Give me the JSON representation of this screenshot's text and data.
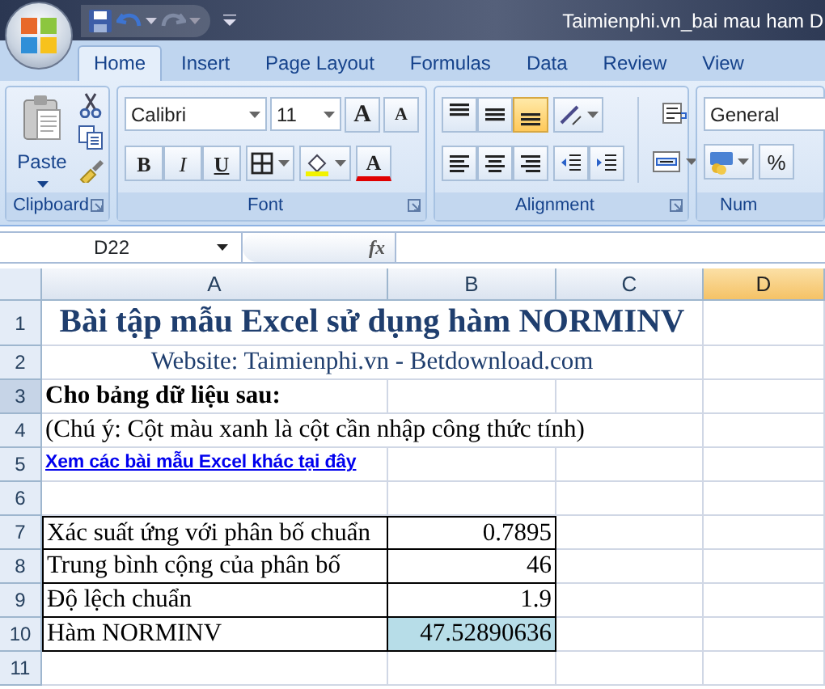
{
  "title_bar": {
    "title": "Taimienphi.vn_bai mau ham D"
  },
  "tabs": [
    {
      "label": "Home",
      "selected": true
    },
    {
      "label": "Insert",
      "selected": false
    },
    {
      "label": "Page Layout",
      "selected": false
    },
    {
      "label": "Formulas",
      "selected": false
    },
    {
      "label": "Data",
      "selected": false
    },
    {
      "label": "Review",
      "selected": false
    },
    {
      "label": "View",
      "selected": false
    }
  ],
  "ribbon": {
    "clipboard": {
      "label": "Clipboard",
      "paste": "Paste"
    },
    "font": {
      "label": "Font",
      "font_name": "Calibri",
      "font_size": "11",
      "grow": "A",
      "shrink": "A",
      "bold": "B",
      "italic": "I",
      "underline": "U",
      "font_color": "A"
    },
    "alignment": {
      "label": "Alignment",
      "vertical": [
        {
          "kind": "top",
          "selected": false
        },
        {
          "kind": "middle",
          "selected": false
        },
        {
          "kind": "bottom",
          "selected": true
        }
      ]
    },
    "number": {
      "label": "Num",
      "format": "General",
      "percent": "%"
    }
  },
  "formula_bar": {
    "name_box": "D22",
    "fx": "fx"
  },
  "sheet": {
    "columns": [
      {
        "label": "A",
        "selected": false
      },
      {
        "label": "B",
        "selected": false
      },
      {
        "label": "C",
        "selected": false
      },
      {
        "label": "D",
        "selected": true
      }
    ],
    "rows": [
      {
        "number": "1",
        "selected": false,
        "cells": [
          {
            "kind": "title",
            "text": "Bài tập mẫu Excel sử dụng hàm NORMINV"
          }
        ]
      },
      {
        "number": "2",
        "selected": false,
        "cells": [
          {
            "kind": "subtitle",
            "text": "Website: Taimienphi.vn - Betdownload.com"
          }
        ]
      },
      {
        "number": "3",
        "selected": true,
        "cells": [
          {
            "kind": "heading",
            "text": "Cho bảng dữ liệu sau:"
          }
        ]
      },
      {
        "number": "4",
        "selected": false,
        "cells": [
          {
            "kind": "note",
            "text": "(Chú ý: Cột màu xanh là cột cần nhập công thức tính)"
          }
        ]
      },
      {
        "number": "5",
        "selected": false,
        "cells": [
          {
            "kind": "link",
            "text": "Xem các bài mẫu Excel khác tại đây"
          }
        ]
      },
      {
        "number": "6",
        "selected": false,
        "cells": []
      },
      {
        "number": "7",
        "selected": false,
        "cells": [
          {
            "kind": "label",
            "text": "Xác suất ứng với phân bố chuẩn"
          },
          {
            "kind": "value",
            "text": "0.7895"
          }
        ]
      },
      {
        "number": "8",
        "selected": false,
        "cells": [
          {
            "kind": "label",
            "text": "Trung bình cộng của phân bố"
          },
          {
            "kind": "value",
            "text": "46"
          }
        ]
      },
      {
        "number": "9",
        "selected": false,
        "cells": [
          {
            "kind": "label",
            "text": "Độ lệch chuẩn"
          },
          {
            "kind": "value",
            "text": "1.9"
          }
        ]
      },
      {
        "number": "10",
        "selected": false,
        "cells": [
          {
            "kind": "label",
            "text": "Hàm NORMINV"
          },
          {
            "kind": "result",
            "text": "47.52890636"
          }
        ]
      },
      {
        "number": "11",
        "selected": false,
        "cells": []
      }
    ]
  }
}
